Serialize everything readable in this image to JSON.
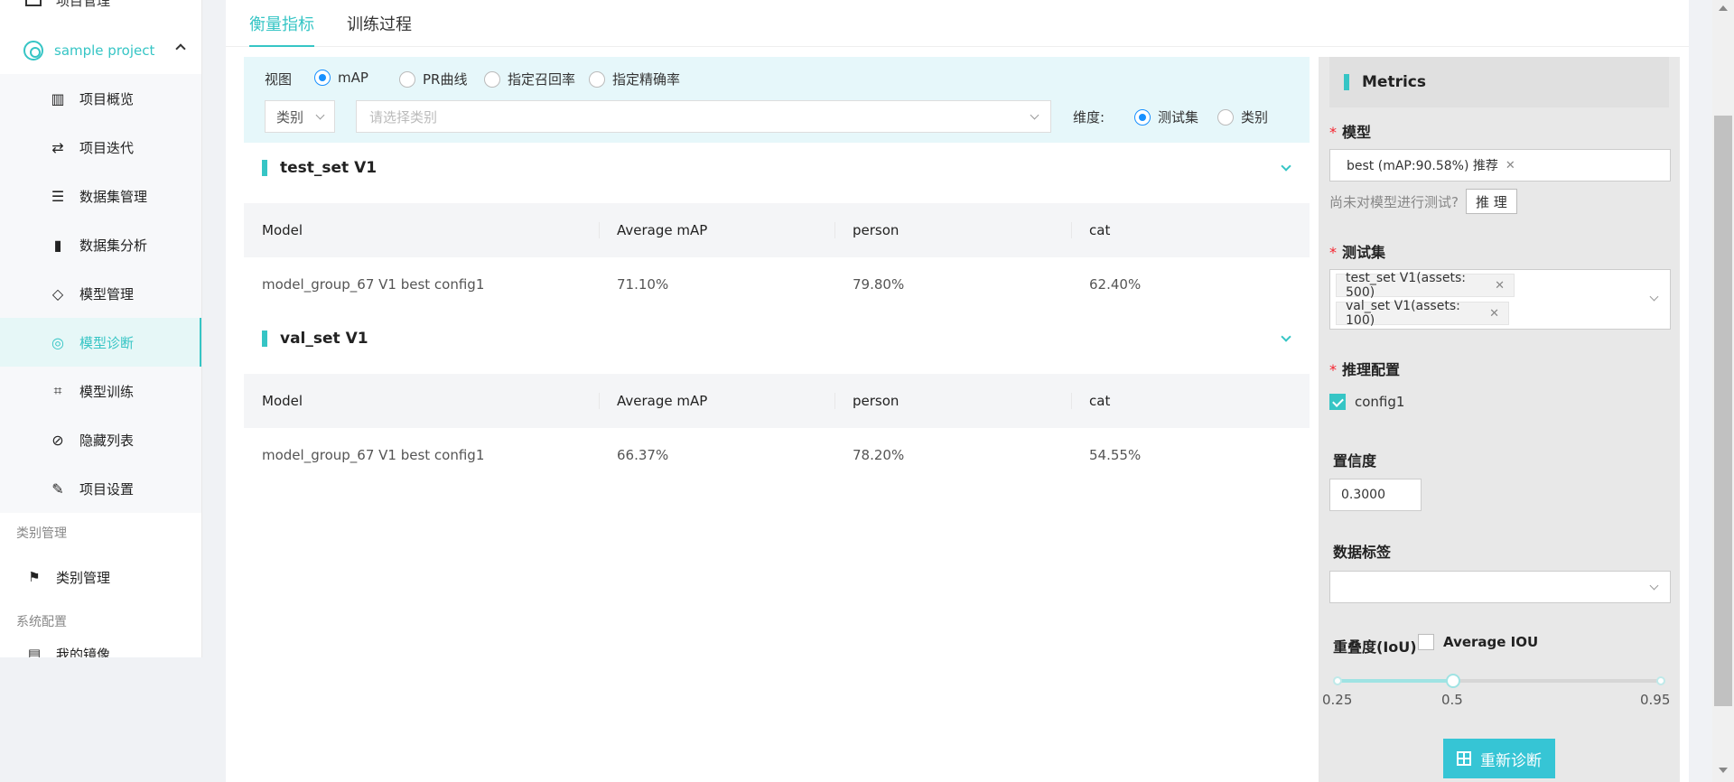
{
  "sidebar": {
    "top_partial": "项目管理",
    "project": "sample project",
    "items": [
      {
        "label": "项目概览",
        "icon": "bar-chart-icon"
      },
      {
        "label": "项目迭代",
        "icon": "repeat-icon"
      },
      {
        "label": "数据集管理",
        "icon": "database-icon"
      },
      {
        "label": "数据集分析",
        "icon": "analysis-chart-icon"
      },
      {
        "label": "模型管理",
        "icon": "cube-icon"
      },
      {
        "label": "模型诊断",
        "icon": "diagnosis-icon"
      },
      {
        "label": "模型训练",
        "icon": "scan-icon"
      },
      {
        "label": "隐藏列表",
        "icon": "eye-off-icon"
      },
      {
        "label": "项目设置",
        "icon": "edit-icon"
      }
    ],
    "group_label": "类别管理",
    "group_item": "类别管理",
    "group2_label": "系统配置",
    "bottom_partial": "我的镜像"
  },
  "tabs": [
    "衡量指标",
    "训练过程"
  ],
  "filter": {
    "view_label": "视图",
    "views": [
      "mAP",
      "PR曲线",
      "指定召回率",
      "指定精确率"
    ],
    "type_select": "类别",
    "class_placeholder": "请选择类别",
    "dimension_label": "维度:",
    "dimensions": [
      "测试集",
      "类别"
    ]
  },
  "sections": [
    {
      "title": "test_set V1",
      "headers": [
        "Model",
        "Average mAP",
        "person",
        "cat"
      ],
      "row": [
        "model_group_67 V1 best config1",
        "71.10%",
        "79.80%",
        "62.40%"
      ]
    },
    {
      "title": "val_set V1",
      "headers": [
        "Model",
        "Average mAP",
        "person",
        "cat"
      ],
      "row": [
        "model_group_67 V1 best config1",
        "66.37%",
        "78.20%",
        "54.55%"
      ]
    }
  ],
  "panel": {
    "title": "Metrics",
    "model_label": "模型",
    "model_tag": "best (mAP:90.58%) 推荐",
    "hint_text": "尚未对模型进行测试?",
    "infer_button": "推 理",
    "testset_label": "测试集",
    "testset_tags": [
      "test_set V1(assets: 500)",
      "val_set V1(assets: 100)"
    ],
    "config_label": "推理配置",
    "config_item": "config1",
    "confidence_label": "置信度",
    "confidence_value": "0.3000",
    "datatag_label": "数据标签",
    "iou_label": "重叠度(IoU)",
    "avg_iou_label": "Average IOU",
    "slider": {
      "min_label": "0.25",
      "mid_label": "0.5",
      "max_label": "0.95",
      "value_fraction": 0.357
    },
    "rediagnose_button": "重新诊断"
  },
  "colors": {
    "accent": "#36c5c5",
    "radio": "#1890ff",
    "button": "#36c5d5"
  }
}
